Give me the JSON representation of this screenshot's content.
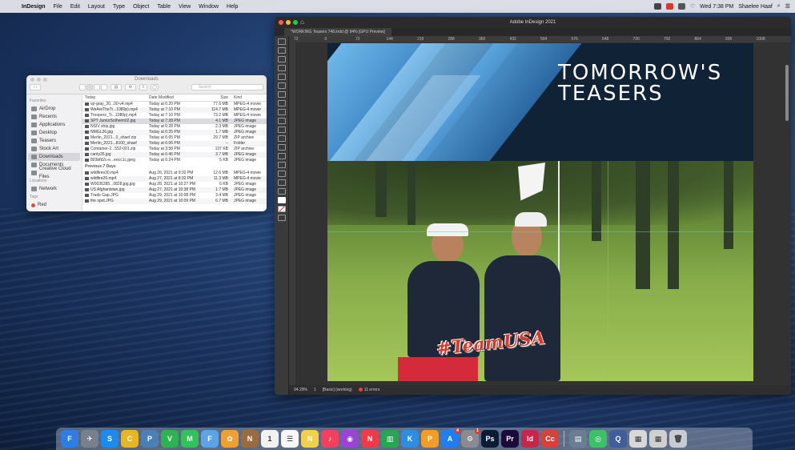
{
  "menubar": {
    "app": "InDesign",
    "items": [
      "File",
      "Edit",
      "Layout",
      "Type",
      "Object",
      "Table",
      "View",
      "Window",
      "Help"
    ],
    "clock": "Wed 7:38 PM",
    "user": "Shaelee Haaf"
  },
  "finder": {
    "title": "Downloads",
    "search_placeholder": "Search",
    "sidebar_favorites_label": "Favorites",
    "sidebar_items": [
      "AirDrop",
      "Recents",
      "Applications",
      "Desktop",
      "Teasers",
      "Stock Art",
      "Downloads",
      "Documents",
      "Creative Cloud Files"
    ],
    "locations_label": "Locations",
    "network": "Network",
    "tags_label": "Tags",
    "tag_red": "Red",
    "columns": {
      "name": "Today",
      "date": "Date Modified",
      "size": "Size",
      "kind": "Kind"
    },
    "today_rows": [
      {
        "name": "vp-gray_20...00-v4.mp4",
        "date": "Today at 6:20 PM",
        "size": "77.6 MB",
        "kind": "MPEG-4 movie"
      },
      {
        "name": "WeAreTheTr...1080p).mp4",
        "date": "Today at 7:10 PM",
        "size": "114.7 MB",
        "kind": "MPEG-4 movie"
      },
      {
        "name": "Troopers_Tr...1080p).mp4",
        "date": "Today at 7:10 PM",
        "size": "73.2 MB",
        "kind": "MPEG-4 movie"
      },
      {
        "name": "SPT JuniorSolheim02.jpg",
        "date": "Today at 7:28 PM",
        "size": "4.1 MB",
        "kind": "JPEG image"
      },
      {
        "name": "NSIV ship.jpg",
        "date": "Today at 6:28 PM",
        "size": "2.3 MB",
        "kind": "JPEG image"
      },
      {
        "name": "NMGL26.jpg",
        "date": "Today at 6:25 PM",
        "size": "1.7 MB",
        "kind": "JPEG image"
      },
      {
        "name": "Merlin_2021...0_shaef.zip",
        "date": "Today at 6:05 PM",
        "size": "29.7 MB",
        "kind": "ZIP archive"
      },
      {
        "name": "Merlin_2021...8100_shaef",
        "date": "Today at 6:06 PM",
        "size": "--",
        "kind": "Folder"
      },
      {
        "name": "Container-2...552-001.zip",
        "date": "Today at 3:58 PM",
        "size": "137 KB",
        "kind": "ZIP archive"
      },
      {
        "name": "canty26.jpg",
        "date": "Today at 6:46 PM",
        "size": "3.7 MB",
        "kind": "JPEG image"
      },
      {
        "name": "893bfd2c-e...eecc1c.jpeg",
        "date": "Today at 6:24 PM",
        "size": "5 KB",
        "kind": "JPEG image"
      }
    ],
    "previous_label": "Previous 7 Days",
    "previous_rows": [
      {
        "name": "wildfires30.mp4",
        "date": "Aug 26, 2021 at 9:32 PM",
        "size": "12.6 MB",
        "kind": "MPEG-4 movie"
      },
      {
        "name": "wildfire26.mp4",
        "date": "Aug 27, 2021 at 8:32 PM",
        "size": "11.3 MB",
        "kind": "MPEG-4 movie"
      },
      {
        "name": "W0036285...0828.jpg.jpg",
        "date": "Aug 28, 2021 at 10:27 PM",
        "size": "6 KB",
        "kind": "JPEG image"
      },
      {
        "name": "US Afghanistan.jpg",
        "date": "Aug 27, 2021 at 10:38 PM",
        "size": "1.7 MB",
        "kind": "JPEG image"
      },
      {
        "name": "Trade Gap.JPG",
        "date": "Aug 29, 2021 at 10:08 PM",
        "size": "3.4 MB",
        "kind": "JPEG image"
      },
      {
        "name": "the spot.JPG",
        "date": "Aug 29, 2021 at 10:09 PM",
        "size": "6.7 MB",
        "kind": "JPEG image"
      }
    ]
  },
  "indesign": {
    "window_title": "Adobe InDesign 2021",
    "doc_tab": "*WORKING Teasers 748.indd @ 94% [GPU Preview]",
    "ruler_marks": [
      "72",
      "0",
      "72",
      "144",
      "216",
      "288",
      "360",
      "432",
      "504",
      "576",
      "648",
      "720",
      "792",
      "864",
      "936",
      "1008"
    ],
    "zoom": "94.29%",
    "page_num": "1",
    "style": "[Basic] (working)",
    "errors": "11 errors",
    "banner_line1": "TOMORROW'S",
    "banner_line2": "TEASERS",
    "sign_text": "#TeamUSA"
  },
  "dock": {
    "apps": [
      {
        "name": "finder",
        "label": "F",
        "color": "#2f7de1"
      },
      {
        "name": "launchpad",
        "label": "✈",
        "color": "#7a7f8c"
      },
      {
        "name": "safari",
        "label": "S",
        "color": "#1c8bf0"
      },
      {
        "name": "chrome",
        "label": "C",
        "color": "#e8b524"
      },
      {
        "name": "preview",
        "label": "P",
        "color": "#4b7fb8"
      },
      {
        "name": "facetime",
        "label": "V",
        "color": "#2fb352"
      },
      {
        "name": "messages",
        "label": "M",
        "color": "#31c25a"
      },
      {
        "name": "finder-alt",
        "label": "F",
        "color": "#5ca4e8"
      },
      {
        "name": "photos",
        "label": "✿",
        "color": "#f0a030"
      },
      {
        "name": "notes-brown",
        "label": "N",
        "color": "#9a6b3e"
      },
      {
        "name": "calendar",
        "label": "1",
        "color": "#f2f2f2"
      },
      {
        "name": "reminders",
        "label": "☰",
        "color": "#f7f7f7"
      },
      {
        "name": "stickies",
        "label": "N",
        "color": "#f1d14a"
      },
      {
        "name": "music",
        "label": "♪",
        "color": "#f2405f"
      },
      {
        "name": "podcasts",
        "label": "◉",
        "color": "#9a44d4"
      },
      {
        "name": "news",
        "label": "N",
        "color": "#f03a47"
      },
      {
        "name": "numbers",
        "label": "▥",
        "color": "#27a552"
      },
      {
        "name": "keynote",
        "label": "K",
        "color": "#2d8de0"
      },
      {
        "name": "pages",
        "label": "P",
        "color": "#f39c27"
      },
      {
        "name": "app-store",
        "label": "A",
        "color": "#1f7ef0"
      },
      {
        "name": "system-preferences",
        "label": "⚙",
        "color": "#8a8a8f"
      },
      {
        "name": "photoshop",
        "label": "Ps",
        "color": "#0b1d34"
      },
      {
        "name": "premiere",
        "label": "Pr",
        "color": "#1a0b3b"
      },
      {
        "name": "indesign",
        "label": "Id",
        "color": "#c7264b"
      },
      {
        "name": "creative-cloud",
        "label": "Cc",
        "color": "#d4423a"
      }
    ],
    "after_apps": [
      {
        "name": "image-capture",
        "label": "▤",
        "color": "#6a7d93"
      },
      {
        "name": "maps",
        "label": "◎",
        "color": "#3ec06b"
      },
      {
        "name": "quicktime",
        "label": "Q",
        "color": "#3e5f9a"
      },
      {
        "name": "downloads-stack",
        "label": "▦",
        "color": "#d8d8d8"
      },
      {
        "name": "documents-stack",
        "label": "▦",
        "color": "#d0d0d0"
      },
      {
        "name": "trash",
        "label": "🗑",
        "color": "#c8cbd0"
      }
    ],
    "badges": {
      "messages": "",
      "calendar": "",
      "app-store": "4",
      "system-preferences": "1"
    }
  }
}
